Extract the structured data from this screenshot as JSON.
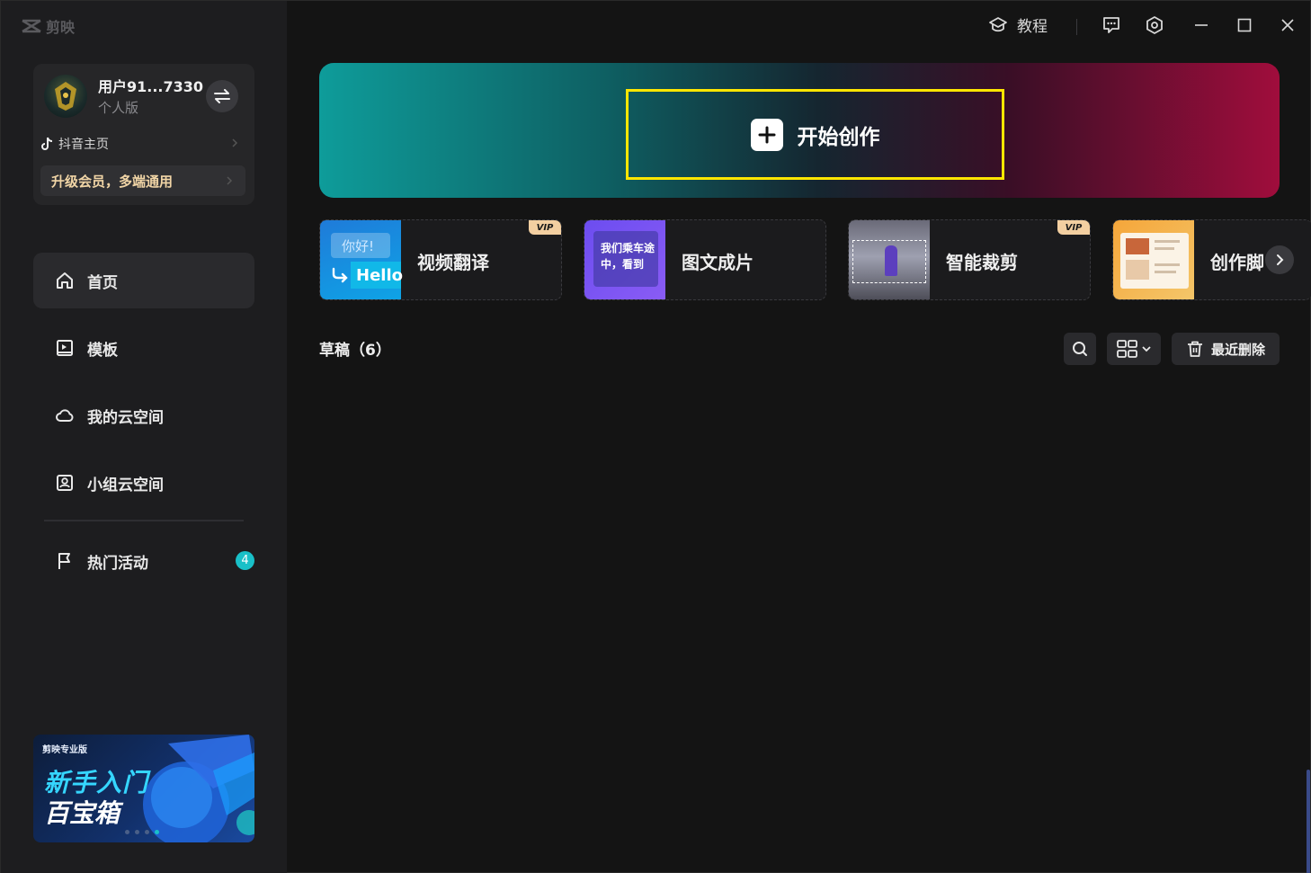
{
  "app": {
    "logo_text": "剪映"
  },
  "user": {
    "name": "用户91...7330",
    "plan": "个人版",
    "douyin_label": "抖音主页",
    "vip_label": "升级会员，多端通用"
  },
  "nav": {
    "home": "首页",
    "templates": "模板",
    "my_cloud": "我的云空间",
    "group_cloud": "小组云空间",
    "hot_events": "热门活动",
    "hot_events_badge": "4"
  },
  "banner": {
    "brand": "剪映专业版",
    "line1": "新手入门",
    "line2": "百宝箱"
  },
  "topbar": {
    "tutorial": "教程"
  },
  "hero": {
    "create_label": "开始创作"
  },
  "features": [
    {
      "label": "视频翻译",
      "vip": "VIP",
      "thumb_top": "你好!",
      "thumb_bottom": "Hello"
    },
    {
      "label": "图文成片",
      "thumb_text_1": "我们乘车途",
      "thumb_text_2": "中，看到"
    },
    {
      "label": "智能裁剪",
      "vip": "VIP"
    },
    {
      "label": "创作脚"
    }
  ],
  "drafts": {
    "title": "草稿（6）",
    "recent_delete": "最近删除"
  },
  "colors": {
    "accent": "#19c0c8",
    "vip_gold": "#f3cfa1",
    "highlight_outline": "#ffe600"
  }
}
